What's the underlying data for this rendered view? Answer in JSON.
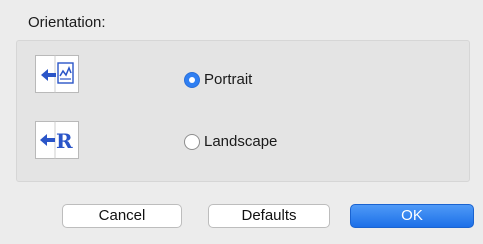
{
  "orientation": {
    "title": "Orientation:",
    "options": [
      {
        "label": "Portrait",
        "selected": true,
        "icon": "portrait-orientation-icon"
      },
      {
        "label": "Landscape",
        "selected": false,
        "icon": "landscape-orientation-icon"
      }
    ],
    "landscape_icon_letter": "R"
  },
  "buttons": {
    "cancel": "Cancel",
    "defaults": "Defaults",
    "ok": "OK"
  },
  "colors": {
    "accent": "#2f7ff2",
    "icon_blue": "#2a55c8"
  }
}
